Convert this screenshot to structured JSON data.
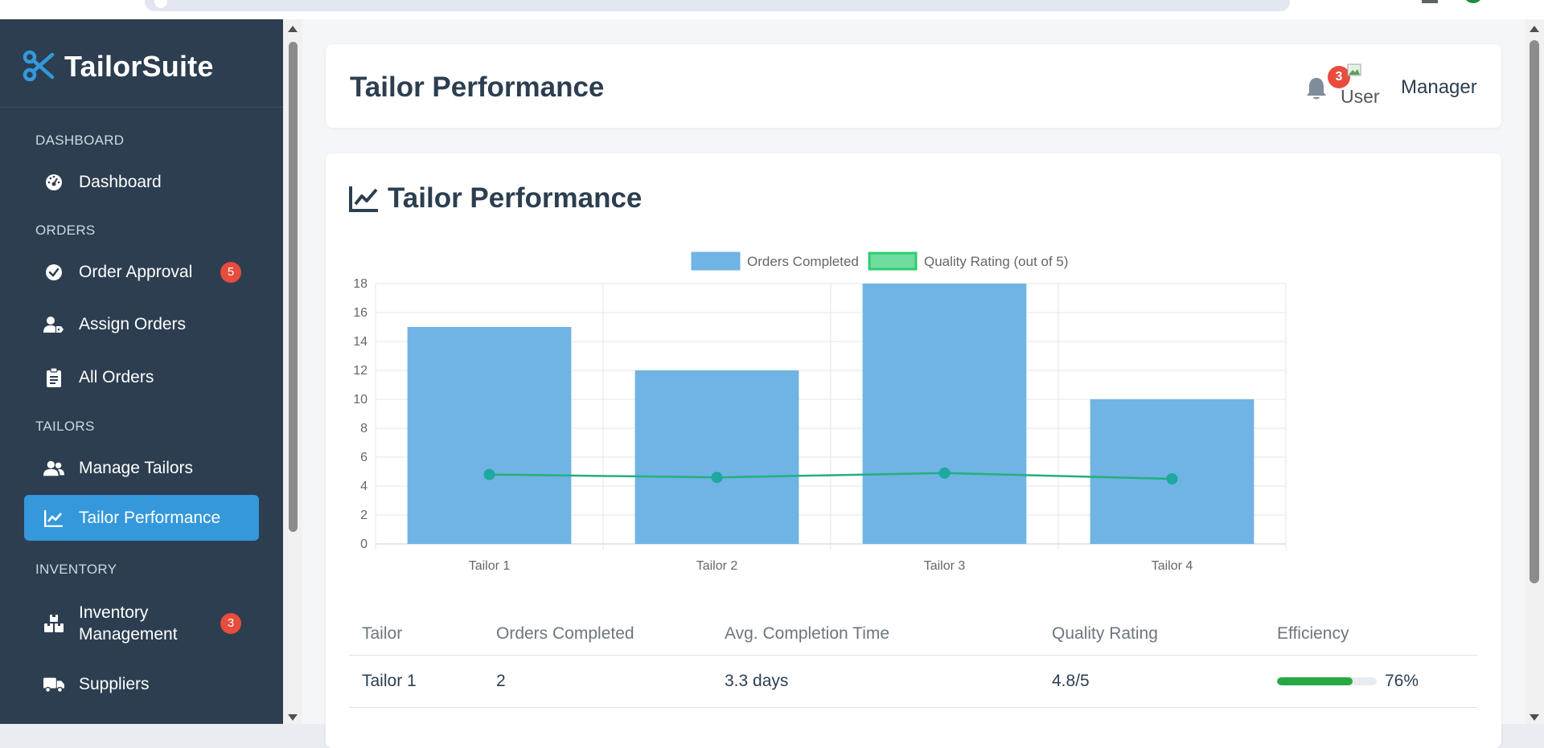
{
  "brand": {
    "name": "TailorSuite",
    "icon": "scissors-icon",
    "accent": "#3498db"
  },
  "header": {
    "title": "Tailor Performance",
    "notification_count": "3",
    "avatar_alt": "User",
    "user_name": "Manager"
  },
  "sidebar": {
    "sections": [
      {
        "label": "DASHBOARD",
        "items": [
          {
            "label": "Dashboard",
            "icon": "gauge-icon"
          }
        ]
      },
      {
        "label": "ORDERS",
        "items": [
          {
            "label": "Order Approval",
            "icon": "check-circle-icon",
            "badge": "5"
          },
          {
            "label": "Assign Orders",
            "icon": "user-tag-icon"
          },
          {
            "label": "All Orders",
            "icon": "clipboard-list-icon"
          }
        ]
      },
      {
        "label": "TAILORS",
        "items": [
          {
            "label": "Manage Tailors",
            "icon": "users-icon"
          },
          {
            "label": "Tailor Performance",
            "icon": "chart-line-icon",
            "active": true
          }
        ]
      },
      {
        "label": "INVENTORY",
        "items": [
          {
            "label": "Inventory Management",
            "icon": "boxes-icon",
            "badge": "3"
          },
          {
            "label": "Suppliers",
            "icon": "truck-icon"
          }
        ]
      }
    ]
  },
  "card": {
    "title": "Tailor Performance",
    "icon": "chart-line-icon"
  },
  "chart_data": {
    "type": "bar",
    "categories": [
      "Tailor 1",
      "Tailor 2",
      "Tailor 3",
      "Tailor 4"
    ],
    "series": [
      {
        "name": "Orders Completed",
        "type": "bar",
        "color": "#6fb4e4",
        "values": [
          15,
          12,
          18,
          10
        ]
      },
      {
        "name": "Quality Rating (out of 5)",
        "type": "line",
        "color": "#2ecc71",
        "values": [
          4.8,
          4.6,
          4.9,
          4.5
        ]
      }
    ],
    "ylim": [
      0,
      18
    ],
    "yticks": [
      0,
      2,
      4,
      6,
      8,
      10,
      12,
      14,
      16,
      18
    ],
    "grid": true,
    "legend": "top-center"
  },
  "table": {
    "columns": [
      "Tailor",
      "Orders Completed",
      "Avg. Completion Time",
      "Quality Rating",
      "Efficiency"
    ],
    "rows": [
      {
        "tailor": "Tailor 1",
        "orders": "2",
        "avg_time": "3.3 days",
        "quality": "4.8/5",
        "efficiency": 76,
        "efficiency_label": "76%"
      }
    ]
  }
}
